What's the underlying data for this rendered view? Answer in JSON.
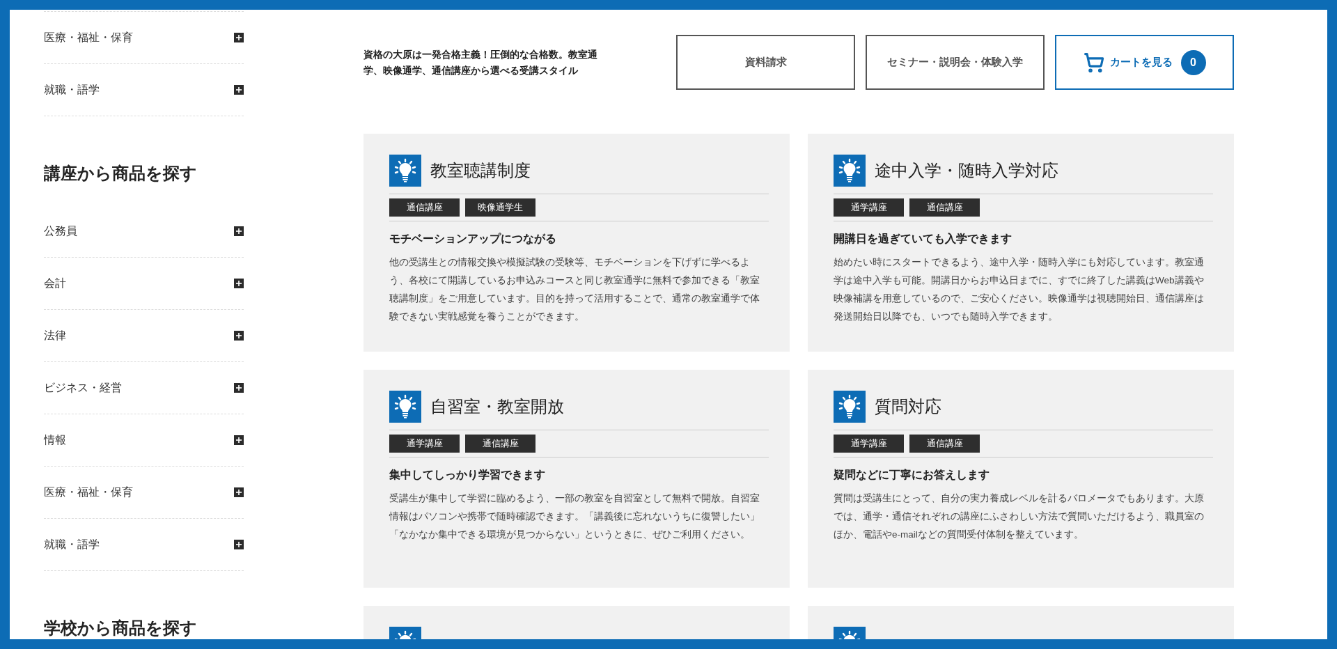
{
  "sidebar": {
    "groups": [
      {
        "items": [
          {
            "label": "医療・福祉・保育",
            "expanded": false
          },
          {
            "label": "就職・語学",
            "expanded": false
          }
        ]
      },
      {
        "heading": "講座から商品を探す",
        "items": [
          {
            "label": "公務員",
            "expanded": false
          },
          {
            "label": "会計",
            "expanded": false
          },
          {
            "label": "法律",
            "expanded": false
          },
          {
            "label": "ビジネス・経営",
            "expanded": false
          },
          {
            "label": "情報",
            "expanded": false
          },
          {
            "label": "医療・福祉・保育",
            "expanded": false
          },
          {
            "label": "就職・語学",
            "expanded": false
          }
        ]
      },
      {
        "heading": "学校から商品を探す"
      }
    ]
  },
  "header": {
    "tagline": "資格の大原は一発合格主義！圧倒的な合格数。教室通学、映像通学、通信講座から選べる受講スタイル",
    "buttons": [
      {
        "kind": "plain",
        "label": "資料請求"
      },
      {
        "kind": "plain",
        "label": "セミナー・説明会・体験入学"
      },
      {
        "kind": "cart",
        "label": "カートを見る",
        "count": "0"
      }
    ]
  },
  "cards": [
    {
      "kind": "full",
      "title": "教室聴講制度",
      "tags": [
        "通信講座",
        "映像通学生"
      ],
      "subtitle": "モチベーションアップにつながる",
      "body": "他の受講生との情報交換や模擬試験の受験等、モチベーションを下げずに学べるよう、各校にて開講しているお申込みコースと同じ教室通学に無料で参加できる「教室聴講制度」をご用意しています。目的を持って活用することで、通常の教室通学で体験できない実戦感覚を養うことができます。"
    },
    {
      "kind": "full",
      "title": "途中入学・随時入学対応",
      "tags": [
        "通学講座",
        "通信講座"
      ],
      "subtitle": "開講日を過ぎていても入学できます",
      "body": "始めたい時にスタートできるよう、途中入学・随時入学にも対応しています。教室通学は途中入学も可能。開講日からお申込日までに、すでに終了した講義はWeb講義や映像補講を用意しているので、ご安心ください。映像通学は視聴開始日、通信講座は発送開始日以降でも、いつでも随時入学できます。"
    },
    {
      "kind": "full",
      "title": "自習室・教室開放",
      "tags": [
        "通学講座",
        "通信講座"
      ],
      "subtitle": "集中してしっかり学習できます",
      "body": "受講生が集中して学習に臨めるよう、一部の教室を自習室として無料で開放。自習室情報はパソコンや携帯で随時確認できます。「講義後に忘れないうちに復讐したい」「なかなか集中できる環境が見つからない」というときに、ぜひご利用ください。"
    },
    {
      "kind": "full",
      "title": "質問対応",
      "tags": [
        "通学講座",
        "通信講座"
      ],
      "subtitle": "疑問などに丁寧にお答えします",
      "body": "質問は受講生にとって、自分の実力養成レベルを計るバロメータでもあります。大原では、通学・通信それぞれの講座にふさわしい方法で質問いただけるよう、職員室のほか、電話やe-mailなどの質問受付体制を整えています。"
    },
    {
      "kind": "cut"
    },
    {
      "kind": "cut"
    }
  ]
}
